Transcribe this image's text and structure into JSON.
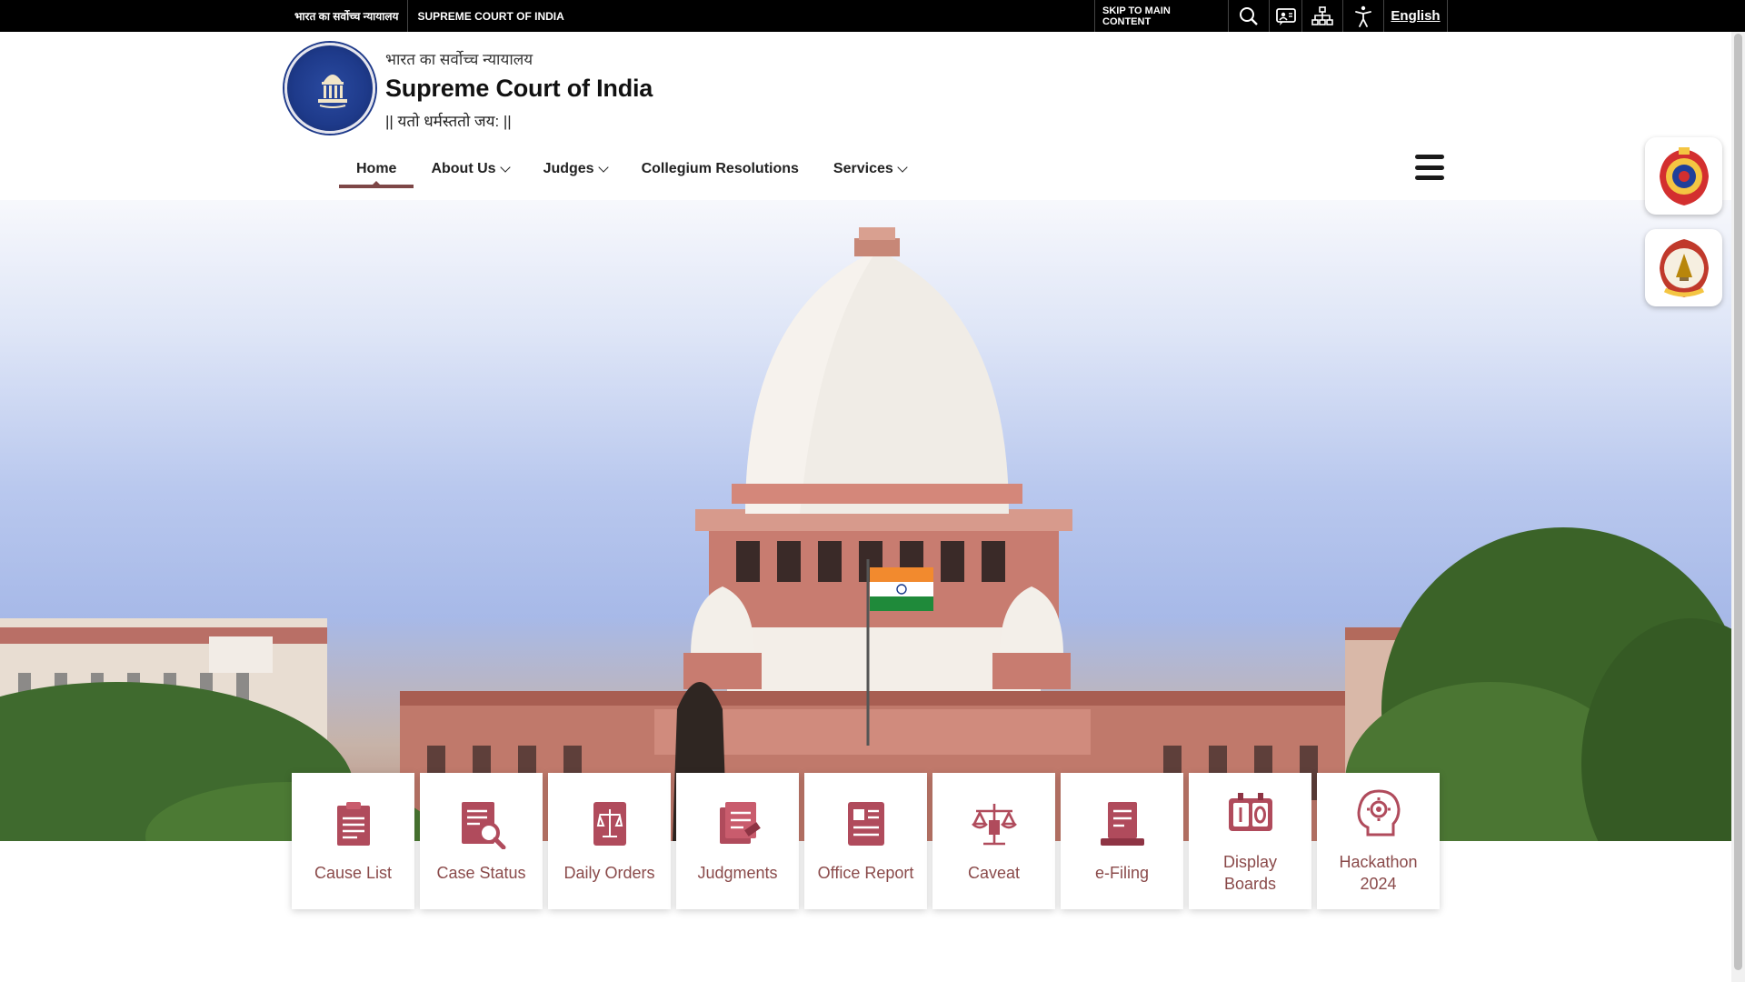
{
  "topbar": {
    "hindi_link": "भारत का सर्वोच्च न्यायालय",
    "english_link": "SUPREME COURT OF INDIA",
    "skip_link": "SKIP TO MAIN CONTENT",
    "language": "English",
    "icons": [
      "search-icon",
      "sign-language-icon",
      "sitemap-icon",
      "accessibility-icon"
    ]
  },
  "header": {
    "title_hindi": "भारत का सर्वोच्च न्यायालय",
    "title": "Supreme Court of India",
    "motto": "|| यतो धर्मस्ततो जय: ||"
  },
  "nav": {
    "items": [
      {
        "label": "Home",
        "active": true
      },
      {
        "label": "About Us",
        "dropdown": true
      },
      {
        "label": "Judges",
        "dropdown": true
      },
      {
        "label": "Collegium Resolutions"
      },
      {
        "label": "Services",
        "dropdown": true
      }
    ]
  },
  "quick_links": [
    {
      "label": "Cause List",
      "icon": "cause-list-icon"
    },
    {
      "label": "Case Status",
      "icon": "case-status-icon"
    },
    {
      "label": "Daily Orders",
      "icon": "daily-orders-icon"
    },
    {
      "label": "Judgments",
      "icon": "judgments-icon"
    },
    {
      "label": "Office Report",
      "icon": "office-report-icon"
    },
    {
      "label": "Caveat",
      "icon": "caveat-icon"
    },
    {
      "label": "e-Filing",
      "icon": "e-filing-icon"
    },
    {
      "label": "Display Boards",
      "icon": "display-boards-icon"
    },
    {
      "label": "Hackathon 2024",
      "icon": "hackathon-icon"
    }
  ],
  "colors": {
    "accent": "#7d4747",
    "icon": "#b04b5c",
    "label": "#8a4a4a"
  }
}
